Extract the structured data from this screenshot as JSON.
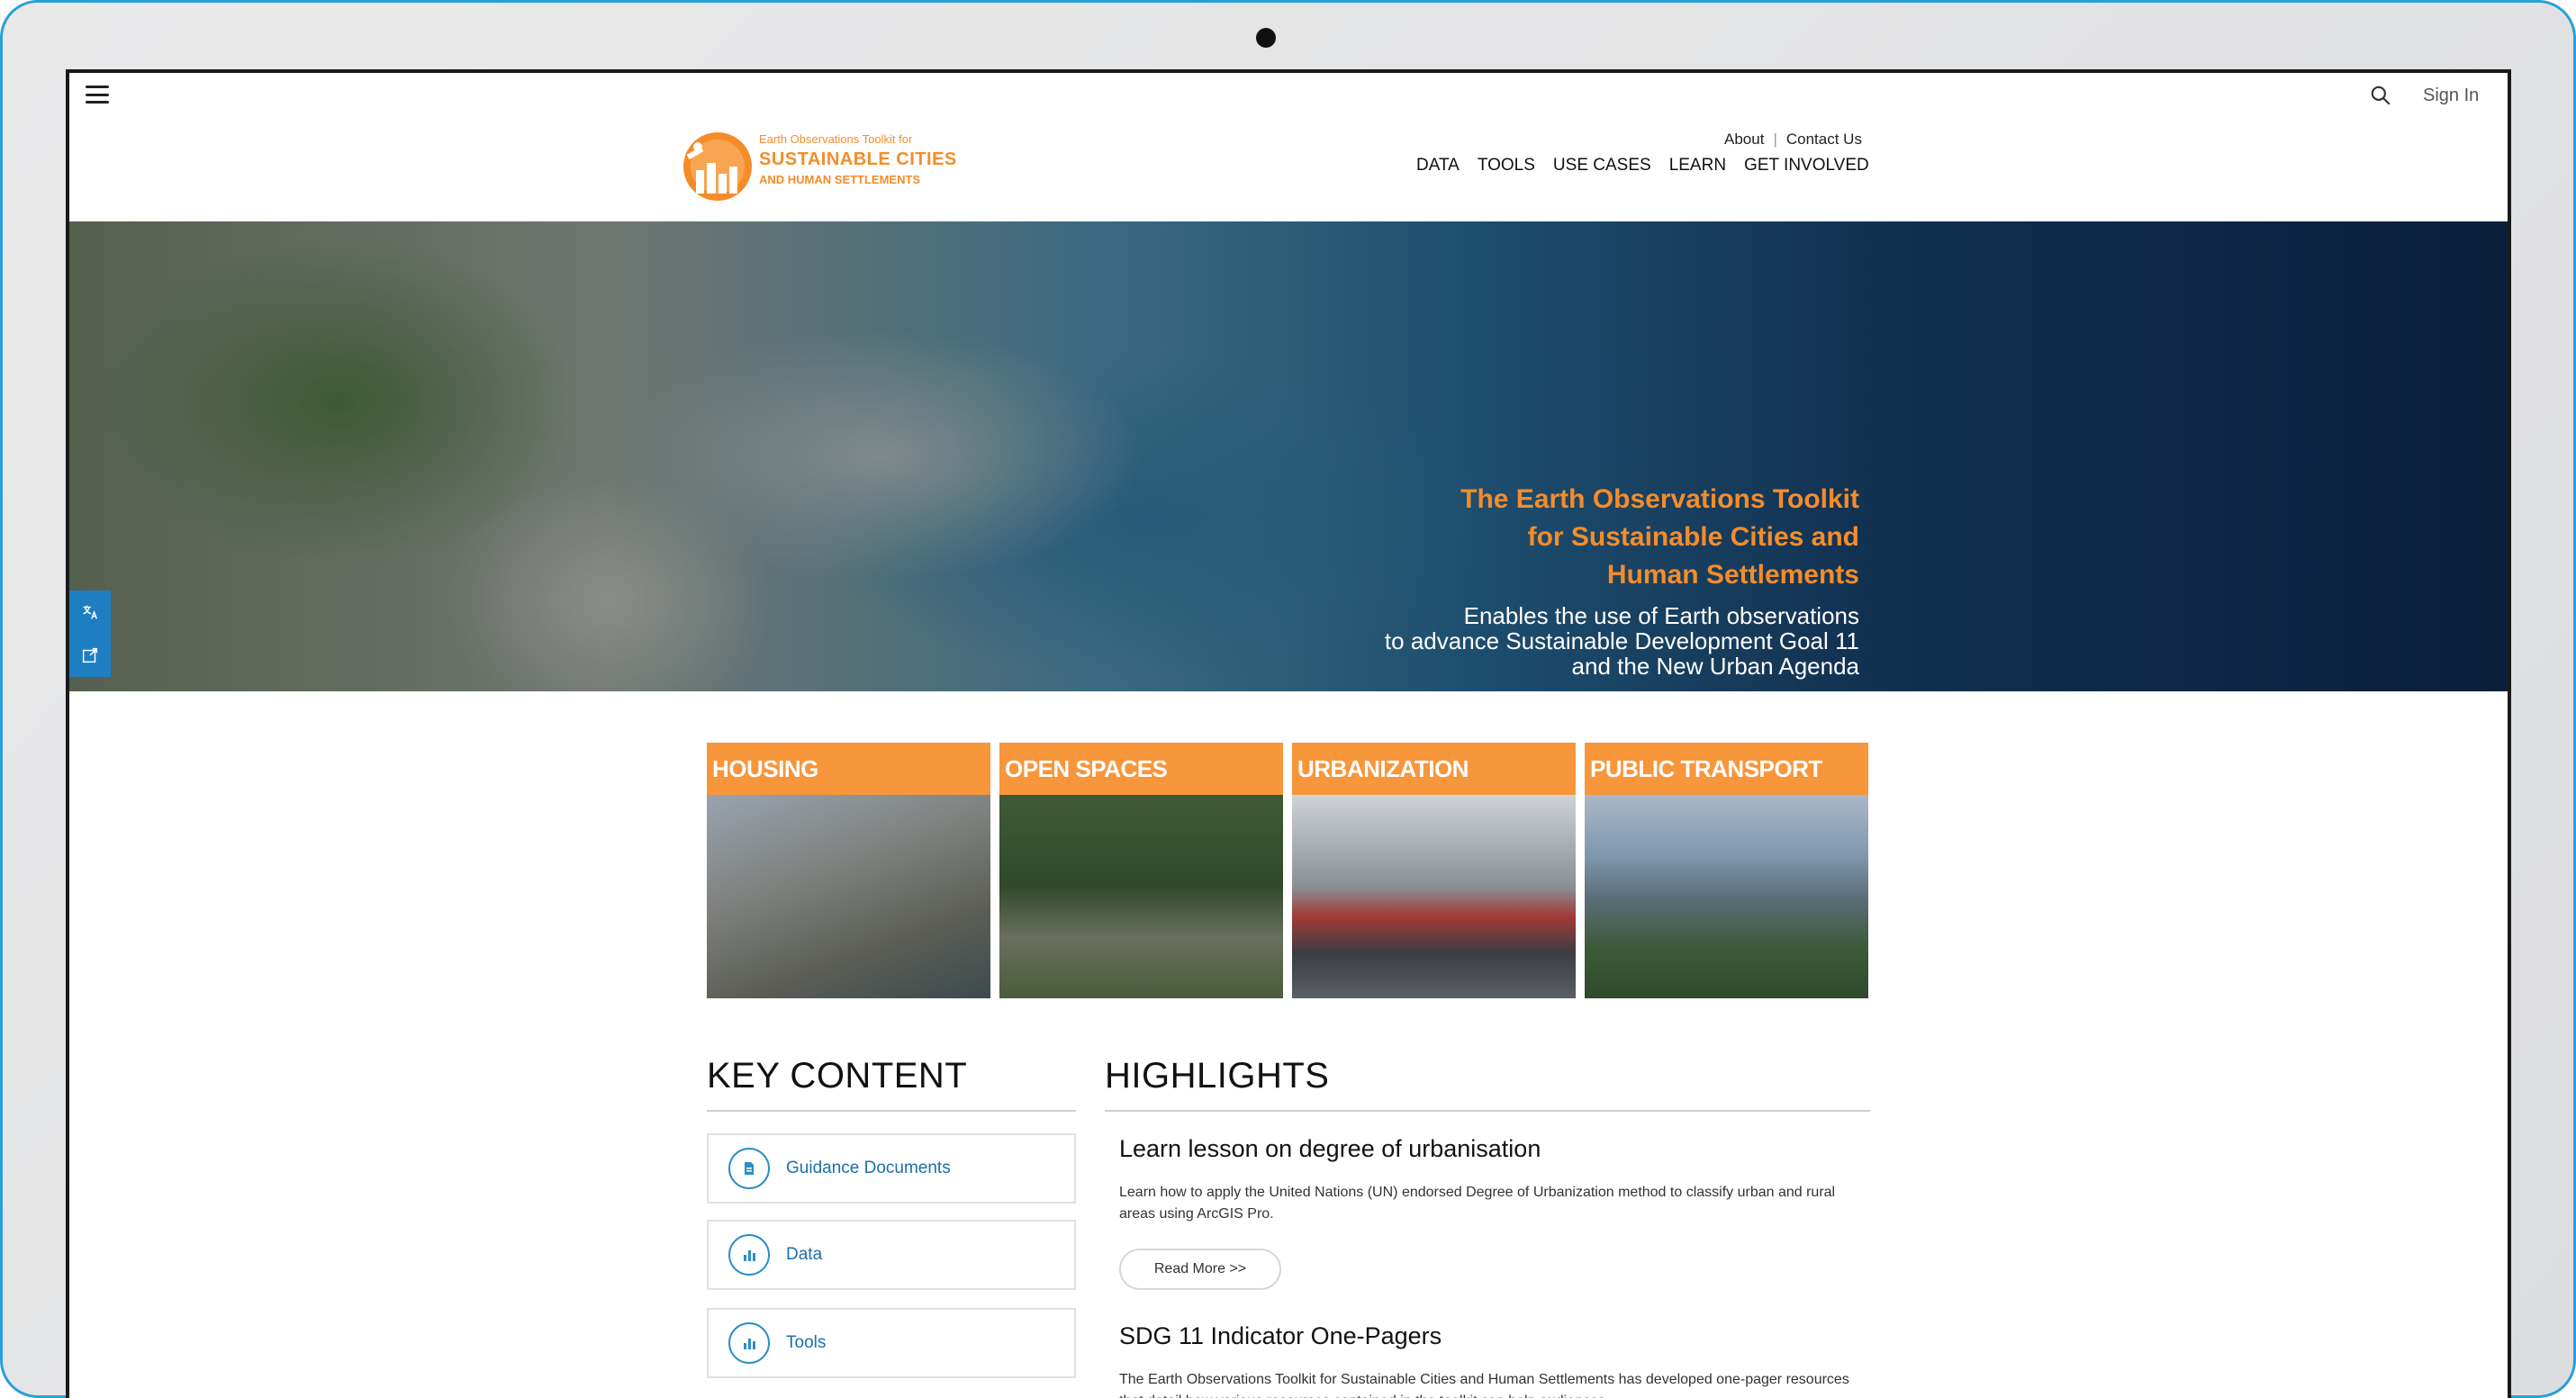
{
  "topbar": {
    "sign_in": "Sign In"
  },
  "logo": {
    "line1": "Earth Observations Toolkit for",
    "line2": "SUSTAINABLE CITIES",
    "line3": "AND HUMAN SETTLEMENTS"
  },
  "util_nav": {
    "about": "About",
    "sep": "|",
    "contact": "Contact Us"
  },
  "main_nav": [
    "DATA",
    "TOOLS",
    "USE CASES",
    "LEARN",
    "GET INVOLVED"
  ],
  "hero": {
    "title_1": "The Earth Observations Toolkit",
    "title_2": "for Sustainable Cities and",
    "title_3": "Human Settlements",
    "sub_1": "Enables the use of Earth observations",
    "sub_2": "to advance Sustainable Development Goal 11",
    "sub_3": "and the New Urban Agenda"
  },
  "tiles": [
    "HOUSING",
    "OPEN SPACES",
    "URBANIZATION",
    "PUBLIC TRANSPORT"
  ],
  "key_content": {
    "title": "KEY CONTENT",
    "items": [
      "Guidance Documents",
      "Data",
      "Tools"
    ]
  },
  "highlights": {
    "title": "HIGHLIGHTS",
    "items": [
      {
        "title": "Learn lesson on degree of urbanisation",
        "text": "Learn how to apply the United Nations (UN) endorsed Degree of Urbanization method to classify urban and rural areas using ArcGIS Pro.",
        "button": "Read More >>"
      },
      {
        "title": "SDG 11 Indicator One-Pagers",
        "text": "The Earth Observations Toolkit for Sustainable Cities and Human Settlements has developed one-pager resources that detail how various resources contained in the toolkit can help audiences"
      }
    ]
  },
  "colors": {
    "accent": "#f58c2a",
    "link": "#1d6fa8",
    "device_border": "#2aa0d8"
  }
}
